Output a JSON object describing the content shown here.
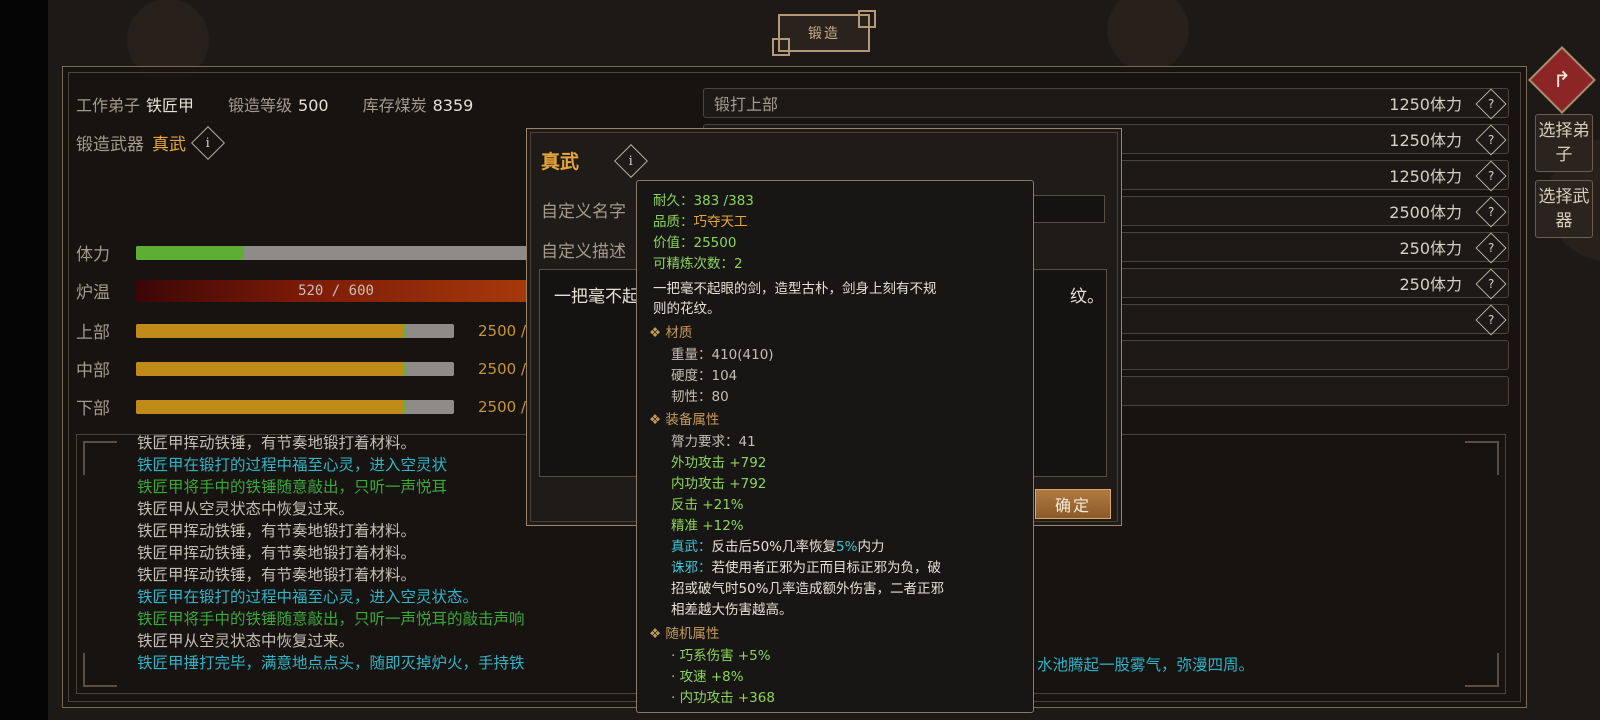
{
  "screen_title": "锻造",
  "top_info": {
    "disciple_label": "工作弟子",
    "disciple_value": "铁匠甲",
    "level_label": "锻造等级",
    "level_value": "500",
    "coal_label": "库存煤炭",
    "coal_value": "8359"
  },
  "weapon": {
    "label": "锻造武器",
    "name": "真武"
  },
  "bars": {
    "stamina": {
      "label": "体力",
      "fill": 0.27,
      "color": "#5fae34"
    },
    "furnace": {
      "label": "炉温",
      "text": "520 / 600",
      "value": 520,
      "max": 600
    },
    "upper": {
      "label": "上部",
      "text": "2500 /",
      "fill": 0.84
    },
    "middle": {
      "label": "中部",
      "text": "2500 /",
      "fill": 0.84
    },
    "lower": {
      "label": "下部",
      "text": "2500 /",
      "fill": 0.84
    }
  },
  "forge_actions": [
    {
      "name": "锻打上部",
      "cost": "1250体力"
    },
    {
      "name": "",
      "cost": "1250体力"
    },
    {
      "name": "",
      "cost": "1250体力"
    },
    {
      "name": "",
      "cost": "2500体力"
    },
    {
      "name": "",
      "cost": "250体力"
    },
    {
      "name": "",
      "cost": "250体力"
    },
    {
      "name": "",
      "cost": ""
    },
    {
      "name": "",
      "cost": ""
    },
    {
      "name": "",
      "cost": ""
    }
  ],
  "side_buttons": {
    "select_disciple": "选择弟子",
    "select_weapon": "选择武器",
    "back_icon": "back-arrow-icon"
  },
  "log_lines": [
    {
      "text": "铁匠甲挥动铁锤，有节奏地锻打着材料。",
      "color": "#c4bdb2"
    },
    {
      "text": "铁匠甲在锻打的过程中福至心灵，进入空灵状",
      "color": "#2fb4c8"
    },
    {
      "text": "铁匠甲将手中的铁锤随意敲出，只听一声悦耳",
      "color": "#3aa83a"
    },
    {
      "text": "铁匠甲从空灵状态中恢复过来。",
      "color": "#c4bdb2"
    },
    {
      "text": "铁匠甲挥动铁锤，有节奏地锻打着材料。",
      "color": "#c4bdb2"
    },
    {
      "text": "铁匠甲挥动铁锤，有节奏地锻打着材料。",
      "color": "#c4bdb2"
    },
    {
      "text": "铁匠甲挥动铁锤，有节奏地锻打着材料。",
      "color": "#c4bdb2"
    },
    {
      "text": "铁匠甲在锻打的过程中福至心灵，进入空灵状态。",
      "color": "#2fb4c8"
    },
    {
      "text": "铁匠甲将手中的铁锤随意敲出，只听一声悦耳的敲击声响",
      "color": "#3aa83a"
    },
    {
      "text": "铁匠甲从空灵状态中恢复过来。",
      "color": "#c4bdb2"
    },
    {
      "text": "铁匠甲捶打完毕，满意地点点头，随即灭掉炉火，手持铁",
      "color": "#2fb4c8"
    }
  ],
  "log_tail": "水池腾起一股雾气，弥漫四周。",
  "dialog": {
    "title": "真武",
    "custom_name_label": "自定义名字",
    "custom_desc_label": "自定义描述",
    "desc_left": "一把毫不起",
    "desc_right": "纹。",
    "ok_label": "确定"
  },
  "tooltip": {
    "durability": "耐久：383 /383",
    "quality_label": "品质：",
    "quality_value": "巧夺天工",
    "price": "价值：25500",
    "refine": "可精炼次数：2",
    "desc1": "一把毫不起眼的剑，造型古朴，剑身上刻有不规",
    "desc2": "则的花纹。",
    "material_head": "❖ 材质",
    "weight": "重量：410(410)",
    "hardness": "硬度：104",
    "toughness": "韧性：80",
    "equip_head": "❖ 装备属性",
    "strength_req": "膂力要求：41",
    "ext_attack": "外功攻击 +792",
    "int_attack": "内功攻击 +792",
    "counter": "反击 +21%",
    "precision": "精准 +12%",
    "skill1_name": "真武：",
    "skill1_text_a": "反击后50%几率恢复",
    "skill1_pct": "5%",
    "skill1_text_b": "内力",
    "skill2_name": "诛邪：",
    "skill2_line1": "若使用者正邪为正而目标正邪为负，破",
    "skill2_line2": "招或破气时50%几率造成额外伤害，二者正邪",
    "skill2_line3": "相差越大伤害越高。",
    "random_head": "❖ 随机属性",
    "rand1": "· 巧系伤害 +5%",
    "rand2": "· 攻速 +8%",
    "rand3": "· 内功攻击 +368"
  }
}
